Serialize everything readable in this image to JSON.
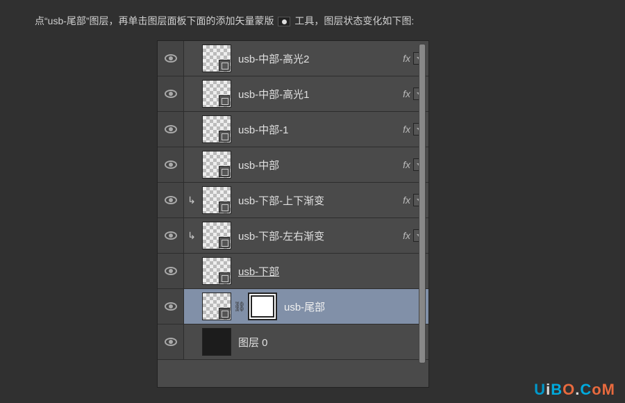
{
  "instruction": {
    "part1": "点“usb-尾部”图层，再单击图层面板下面的添加矢量蒙版",
    "part2": "工具，图层状态变化如下图:"
  },
  "layers": [
    {
      "name": "usb-中部-高光2",
      "fx": true,
      "clipped": false,
      "hasVectorBadge": true,
      "hasMask": false,
      "selected": false,
      "underlined": false,
      "solid": false
    },
    {
      "name": "usb-中部-高光1",
      "fx": true,
      "clipped": false,
      "hasVectorBadge": true,
      "hasMask": false,
      "selected": false,
      "underlined": false,
      "solid": false
    },
    {
      "name": "usb-中部-1",
      "fx": true,
      "clipped": false,
      "hasVectorBadge": true,
      "hasMask": false,
      "selected": false,
      "underlined": false,
      "solid": false
    },
    {
      "name": "usb-中部",
      "fx": true,
      "clipped": false,
      "hasVectorBadge": true,
      "hasMask": false,
      "selected": false,
      "underlined": false,
      "solid": false
    },
    {
      "name": "usb-下部-上下渐变",
      "fx": true,
      "clipped": true,
      "hasVectorBadge": true,
      "hasMask": false,
      "selected": false,
      "underlined": false,
      "solid": false
    },
    {
      "name": "usb-下部-左右渐变",
      "fx": true,
      "clipped": true,
      "hasVectorBadge": true,
      "hasMask": false,
      "selected": false,
      "underlined": false,
      "solid": false
    },
    {
      "name": "usb-下部",
      "fx": false,
      "clipped": false,
      "hasVectorBadge": true,
      "hasMask": false,
      "selected": false,
      "underlined": true,
      "solid": false
    },
    {
      "name": "usb-尾部",
      "fx": false,
      "clipped": false,
      "hasVectorBadge": true,
      "hasMask": true,
      "selected": true,
      "underlined": false,
      "solid": false
    },
    {
      "name": "图层 0",
      "fx": false,
      "clipped": false,
      "hasVectorBadge": false,
      "hasMask": false,
      "selected": false,
      "underlined": false,
      "solid": true
    }
  ],
  "fxLabel": "fx",
  "clipSymbol": "↳",
  "linkSymbol": "⛓",
  "watermark": {
    "u": "U",
    "i": "i",
    "b": "B",
    "o": "O",
    "dot": ".",
    "c": "C",
    "o2": "o",
    "m": "M"
  }
}
